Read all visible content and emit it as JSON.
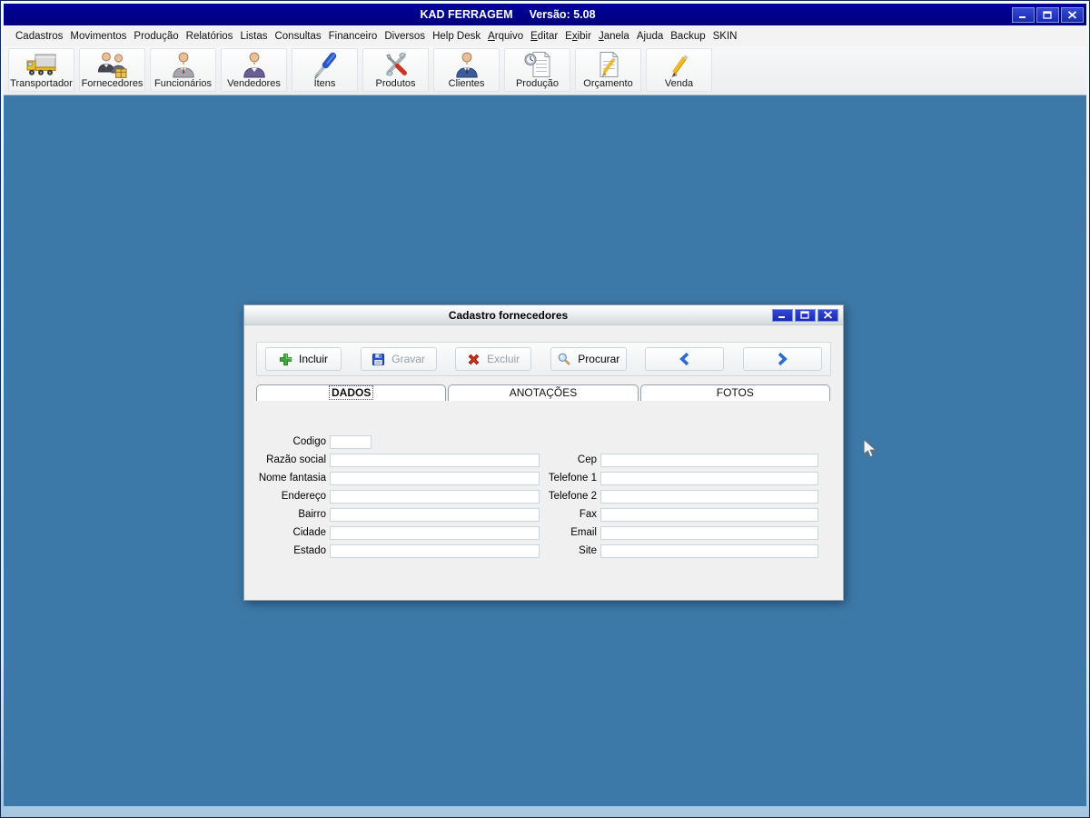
{
  "window": {
    "title": "KAD FERRAGEM",
    "version": "Versão: 5.08",
    "controls": [
      "minimize",
      "maximize",
      "close"
    ]
  },
  "menu": {
    "items": [
      {
        "label": "Cadastros"
      },
      {
        "label": "Movimentos"
      },
      {
        "label": "Produção"
      },
      {
        "label": "Relatórios"
      },
      {
        "label": "Listas"
      },
      {
        "label": "Consultas"
      },
      {
        "label": "Financeiro"
      },
      {
        "label": "Diversos"
      },
      {
        "label": "Help Desk"
      },
      {
        "label": "Arquivo",
        "underline": 0
      },
      {
        "label": "Editar",
        "underline": 0
      },
      {
        "label": "Exibir",
        "underline": 1
      },
      {
        "label": "Janela",
        "underline": 0
      },
      {
        "label": "Ajuda"
      },
      {
        "label": "Backup"
      },
      {
        "label": "SKIN"
      }
    ]
  },
  "toolbar": {
    "buttons": [
      {
        "label": "Transportador",
        "icon": "truck-icon"
      },
      {
        "label": "Fornecedores",
        "icon": "suppliers-icon"
      },
      {
        "label": "Funcionários",
        "icon": "employee-icon"
      },
      {
        "label": "Vendedores",
        "icon": "seller-icon"
      },
      {
        "label": "Ítens",
        "icon": "screwdriver-icon"
      },
      {
        "label": "Produtos",
        "icon": "tools-icon"
      },
      {
        "label": "Clientes",
        "icon": "client-icon"
      },
      {
        "label": "Produção",
        "icon": "production-doc-icon"
      },
      {
        "label": "Orçamento",
        "icon": "budget-doc-icon"
      },
      {
        "label": "Venda",
        "icon": "pencil-icon"
      }
    ]
  },
  "dialog": {
    "title": "Cadastro fornecedores",
    "controls": [
      "minimize",
      "maximize",
      "close"
    ],
    "toolbar": {
      "buttons": [
        {
          "label": "Incluir",
          "icon": "plus-icon",
          "disabled": false
        },
        {
          "label": "Gravar",
          "icon": "save-icon",
          "disabled": true
        },
        {
          "label": "Excluir",
          "icon": "delete-icon",
          "disabled": true
        },
        {
          "label": "Procurar",
          "icon": "search-icon",
          "disabled": false
        }
      ],
      "nav": [
        {
          "icon": "chevron-left-icon"
        },
        {
          "icon": "chevron-right-icon"
        }
      ]
    },
    "tabs": [
      {
        "label": "DADOS",
        "active": true
      },
      {
        "label": "ANOTAÇÕES",
        "active": false
      },
      {
        "label": "FOTOS",
        "active": false
      }
    ],
    "form": {
      "left_fields": [
        {
          "label": "Codigo",
          "value": "",
          "small": true
        },
        {
          "label": "Razão social",
          "value": ""
        },
        {
          "label": "Nome fantasia",
          "value": ""
        },
        {
          "label": "Endereço",
          "value": ""
        },
        {
          "label": "Bairro",
          "value": ""
        },
        {
          "label": "Cidade",
          "value": ""
        },
        {
          "label": "Estado",
          "value": ""
        }
      ],
      "right_fields": [
        {
          "label": "Cep",
          "value": ""
        },
        {
          "label": "Telefone 1",
          "value": ""
        },
        {
          "label": "Telefone 2",
          "value": ""
        },
        {
          "label": "Fax",
          "value": ""
        },
        {
          "label": "Email",
          "value": ""
        },
        {
          "label": "Site",
          "value": ""
        }
      ]
    }
  }
}
